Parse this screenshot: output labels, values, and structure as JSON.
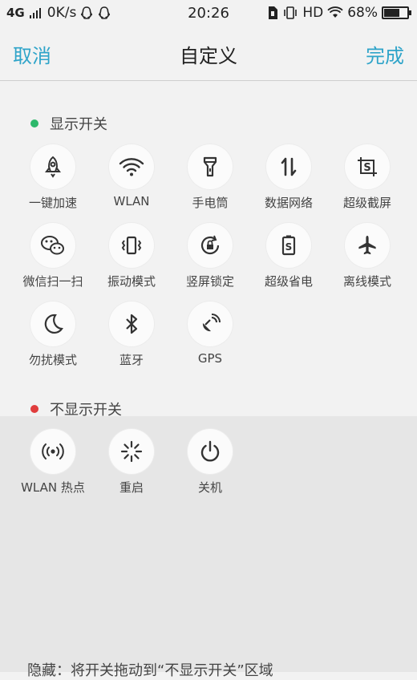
{
  "status_bar": {
    "network": "4G",
    "speed": "0K/s",
    "time": "20:26",
    "hd": "HD",
    "battery_percent": "68%",
    "battery_level": 0.68,
    "icons": [
      "signal-icon",
      "qq-icon",
      "qq-icon",
      "sim-icon",
      "vibrate-icon",
      "wifi-icon",
      "battery-icon"
    ]
  },
  "header": {
    "cancel_label": "取消",
    "title": "自定义",
    "done_label": "完成",
    "accent_color": "#2fa4c9"
  },
  "shown_section": {
    "label": "显示开关",
    "dot_color": "#2db86b",
    "items": [
      {
        "label": "一键加速",
        "icon": "rocket-icon"
      },
      {
        "label": "WLAN",
        "icon": "wifi-icon"
      },
      {
        "label": "手电筒",
        "icon": "flashlight-icon"
      },
      {
        "label": "数据网络",
        "icon": "data-network-icon"
      },
      {
        "label": "超级截屏",
        "icon": "screenshot-icon"
      },
      {
        "label": "微信扫一扫",
        "icon": "wechat-scan-icon"
      },
      {
        "label": "振动模式",
        "icon": "vibrate-icon"
      },
      {
        "label": "竖屏锁定",
        "icon": "rotation-lock-icon"
      },
      {
        "label": "超级省电",
        "icon": "power-saving-icon"
      },
      {
        "label": "离线模式",
        "icon": "airplane-icon"
      },
      {
        "label": "勿扰模式",
        "icon": "moon-icon"
      },
      {
        "label": "蓝牙",
        "icon": "bluetooth-icon"
      },
      {
        "label": "GPS",
        "icon": "gps-icon"
      }
    ]
  },
  "hidden_section": {
    "label": "不显示开关",
    "dot_color": "#e03d3d",
    "items": [
      {
        "label": "WLAN 热点",
        "icon": "hotspot-icon"
      },
      {
        "label": "重启",
        "icon": "restart-icon"
      },
      {
        "label": "关机",
        "icon": "power-icon"
      }
    ]
  },
  "footer": {
    "hint": "隐藏：将开关拖动到“不显示开关”区域"
  }
}
